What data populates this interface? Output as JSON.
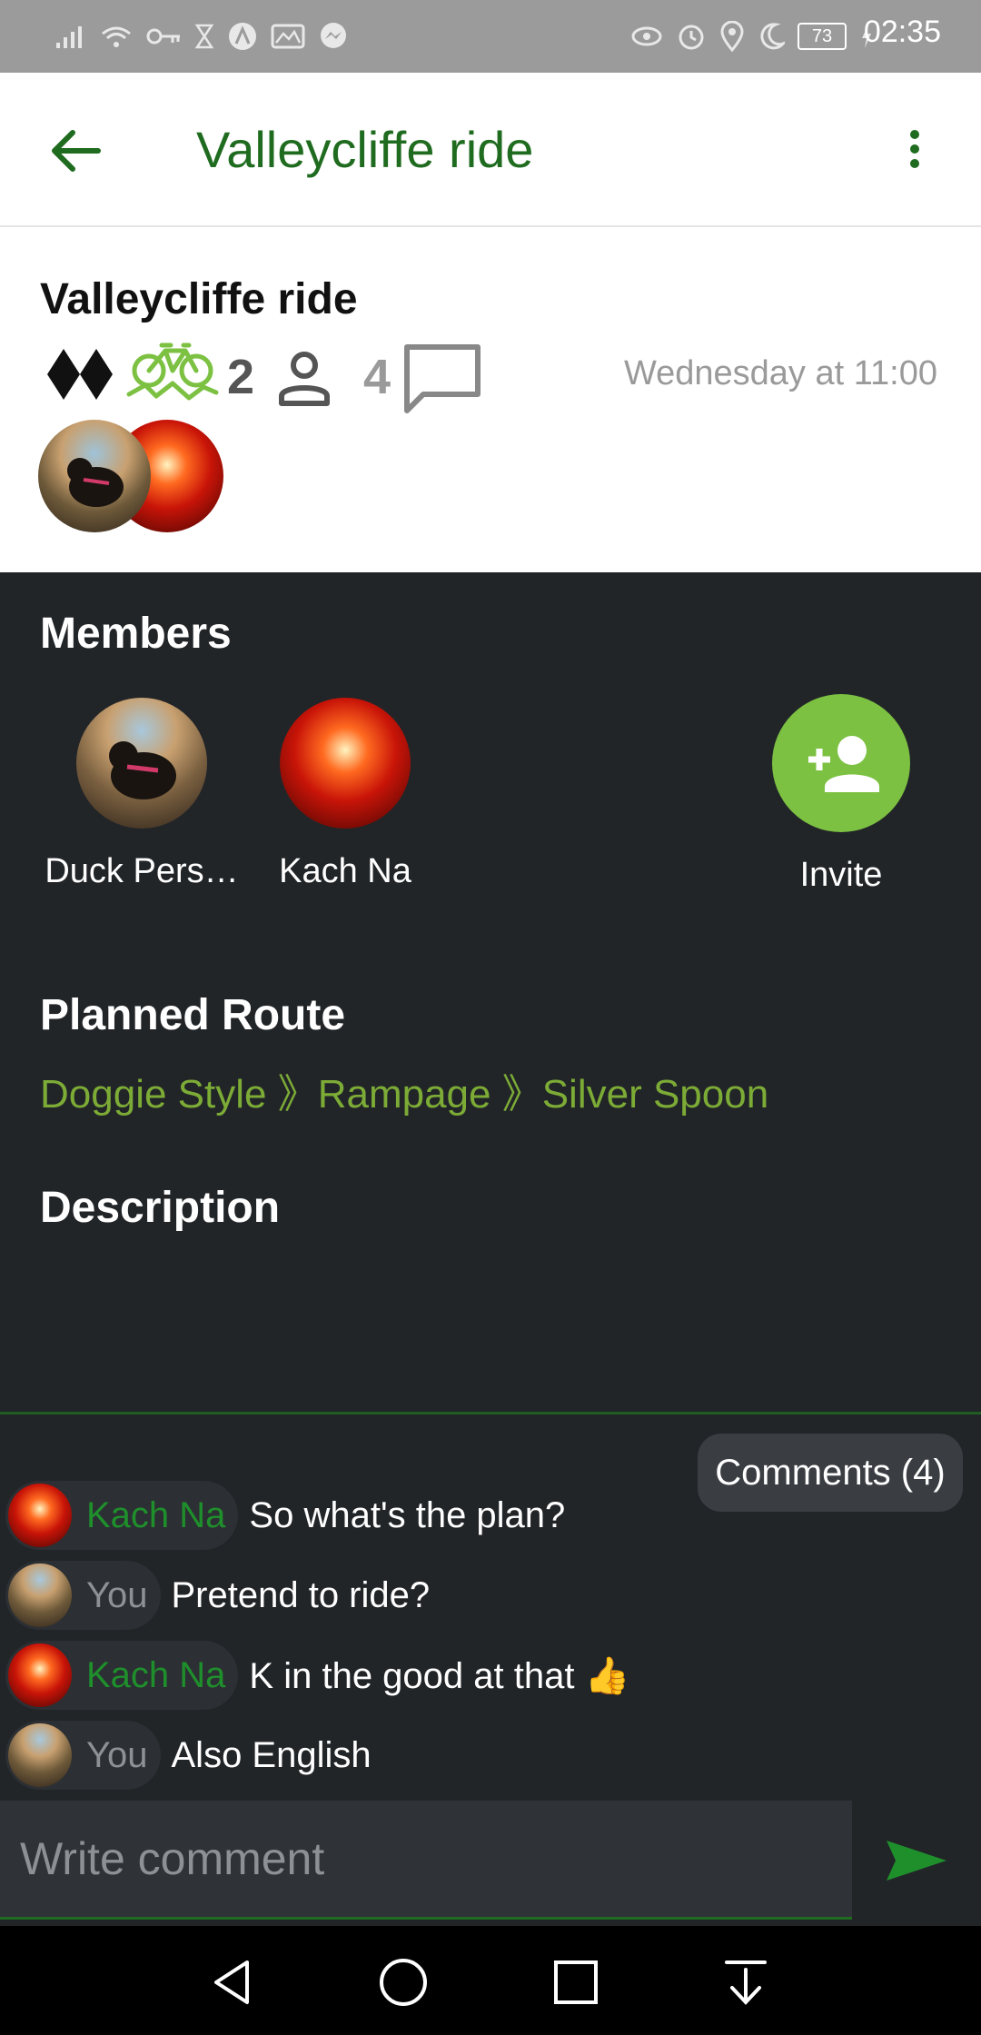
{
  "status_bar": {
    "time": "02:35",
    "battery": "73"
  },
  "app_bar": {
    "title": "Valleycliffe ride",
    "back_icon": "arrow-back-icon",
    "menu_icon": "more-vertical-icon"
  },
  "ride": {
    "title": "Valleycliffe ride",
    "difficulty_icon": "double-black-diamond-icon",
    "bike_icon": "mountain-bike-icon",
    "participants_count": "2",
    "comments_count": "4",
    "date": "Wednesday at 11:00"
  },
  "members": {
    "title": "Members",
    "list": [
      {
        "name": "Duck Pers…"
      },
      {
        "name": "Kach Na"
      }
    ],
    "invite_label": "Invite"
  },
  "route": {
    "title": "Planned Route",
    "text": "Doggie Style 》Rampage 》Silver Spoon"
  },
  "description": {
    "title": "Description"
  },
  "comments": {
    "chip_label": "Comments (4)",
    "items": [
      {
        "author": "Kach Na",
        "text": "So what's the plan?"
      },
      {
        "author": "You",
        "text": "Pretend to ride?"
      },
      {
        "author": "Kach Na",
        "text": "K in the good at that 👍"
      },
      {
        "author": "You",
        "text": "Also English"
      }
    ],
    "input_placeholder": "Write comment"
  },
  "colors": {
    "accent_green": "#1f6b1f",
    "light_green": "#7cab36",
    "invite_green": "#7cc142",
    "dark_bg": "#222528"
  }
}
